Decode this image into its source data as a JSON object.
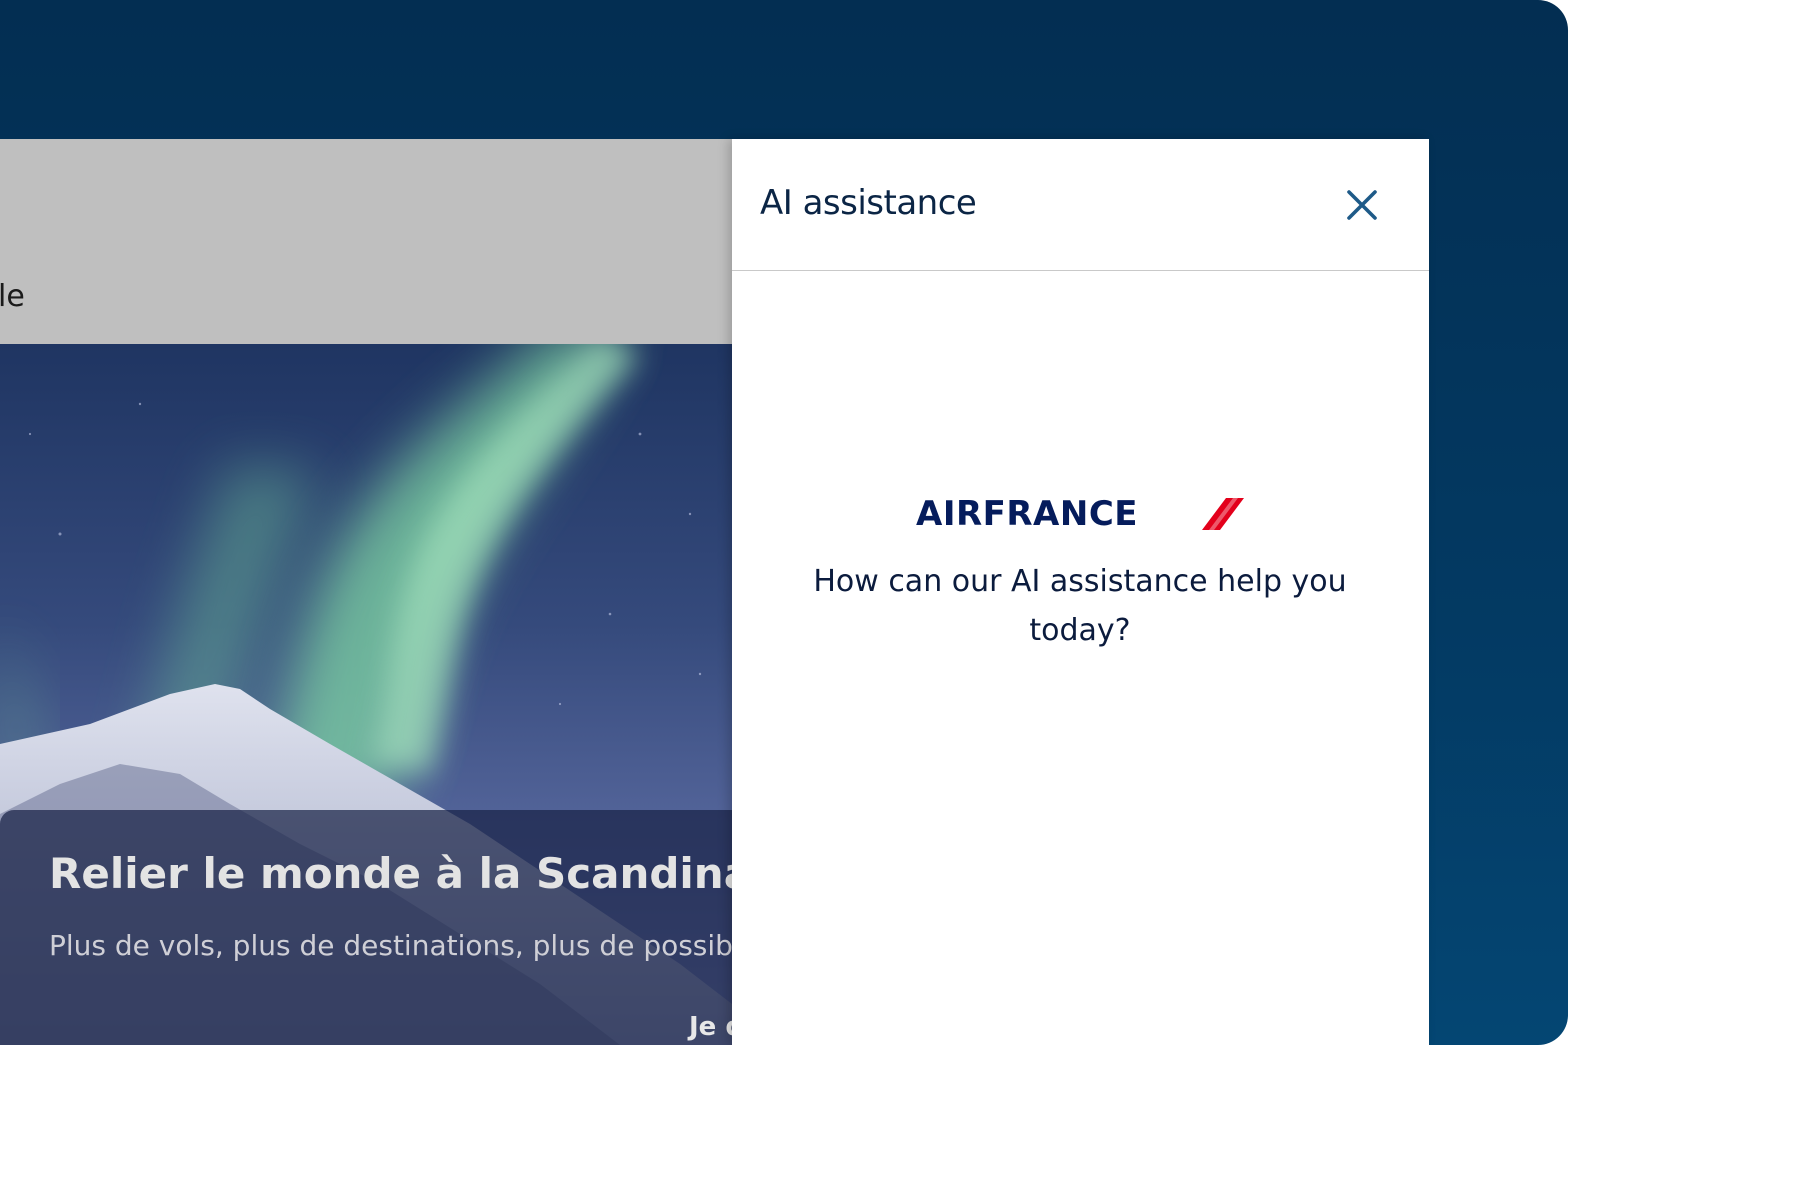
{
  "background_page": {
    "nav_fragment": "le",
    "hero": {
      "title": "Relier le monde à la Scandinavie",
      "subtitle": "Plus de vols, plus de destinations, plus de possibilités",
      "link": "Je découvre"
    }
  },
  "assistant_panel": {
    "title": "AI assistance",
    "close_icon": "close-icon",
    "logo": {
      "text": "AIRFRANCE",
      "accent_color": "#e3001b"
    },
    "welcome_message": "How can our AI assistance help you today?"
  },
  "colors": {
    "frame_background": "#033a63",
    "brand_navy": "#051c5c",
    "close_icon": "#1e5a88"
  }
}
